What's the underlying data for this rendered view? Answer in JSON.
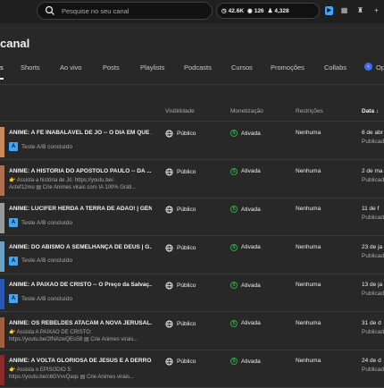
{
  "search": {
    "placeholder": "Pesquise no seu canal"
  },
  "stats": {
    "views": "42.6K",
    "watch": "126",
    "subs": "4,328"
  },
  "page": {
    "title": "canal"
  },
  "tabs": [
    {
      "label": "s"
    },
    {
      "label": "Shorts"
    },
    {
      "label": "Ao vivo"
    },
    {
      "label": "Posts"
    },
    {
      "label": "Playlists"
    },
    {
      "label": "Podcasts"
    },
    {
      "label": "Cursos"
    },
    {
      "label": "Promoções"
    },
    {
      "label": "Collabs"
    },
    {
      "label": "Op"
    }
  ],
  "columns": {
    "visibility": "Visibilidade",
    "monetization": "Monetização",
    "restrictions": "Restrições",
    "date": "Data"
  },
  "colors": {
    "accent": "#3ea6ff",
    "green": "#2ba640",
    "background": "#282828"
  },
  "videos": [
    {
      "title": "ANIME: A FÉ INABALÁVEL DE JÓ -- O DIA EM QUE ...",
      "sub1": "",
      "sub2": "Teste A/B concluído",
      "visibility": "Público",
      "monetization": "Ativada",
      "restriction": "Nenhuma",
      "date": "6 de abr",
      "status": "Publicad"
    },
    {
      "title": "ANIME: A HISTÓRIA DO APÓSTOLO PAULO -- DA ...",
      "sub1": "👉 Assista a história de Jó: https://youtu.be/-",
      "sub2": "Actef12mo ▤ Crie Animes virais com IA 100% Gráti...",
      "visibility": "Público",
      "monetization": "Ativada",
      "restriction": "Nenhuma",
      "date": "2 de ma",
      "status": "Publicad"
    },
    {
      "title": "ANIME: LÚCIFER HERDA A TERRA DE ADÃO! | GÊN...",
      "sub1": "",
      "sub2": "Teste A/B concluído",
      "visibility": "Público",
      "monetization": "Ativada",
      "restriction": "Nenhuma",
      "date": "11 de f",
      "status": "Publicad"
    },
    {
      "title": "ANIME: DO ABISMO À SEMELHANÇA DE DEUS | G...",
      "sub1": "",
      "sub2": "Teste A/B concluído",
      "visibility": "Público",
      "monetization": "Ativada",
      "restriction": "Nenhuma",
      "date": "23 de ja",
      "status": "Publicad"
    },
    {
      "title": "ANIME: A PAIXÃO DE CRISTO -- O Preço da Salvaç...",
      "sub1": "",
      "sub2": "Teste A/B concluído",
      "visibility": "Público",
      "monetization": "Ativada",
      "restriction": "Nenhuma",
      "date": "13 de ja",
      "status": "Publicad"
    },
    {
      "title": "ANIME: OS REBELDES ATACAM A NOVA JERUSAL...",
      "sub1": "👉 Assista A PAIXÃO DE CRISTO:",
      "sub2": "https://youtu.be/2fNAzwQEsS8 ▤ Crie Animes virais...",
      "visibility": "Público",
      "monetization": "Ativada",
      "restriction": "Nenhuma",
      "date": "31 de d",
      "status": "Publicad"
    },
    {
      "title": "ANIME: A VOLTA GLORIOSA DE JESUS E A DERRO...",
      "sub1": "👉 Assista o EPISÓDIO 5:",
      "sub2": "https://youtu.be/c6GVvvQaqs ▤ Crie Animes virais...",
      "visibility": "Público",
      "monetization": "Ativada",
      "restriction": "Nenhuma",
      "date": "24 de d",
      "status": "Publicad"
    }
  ]
}
